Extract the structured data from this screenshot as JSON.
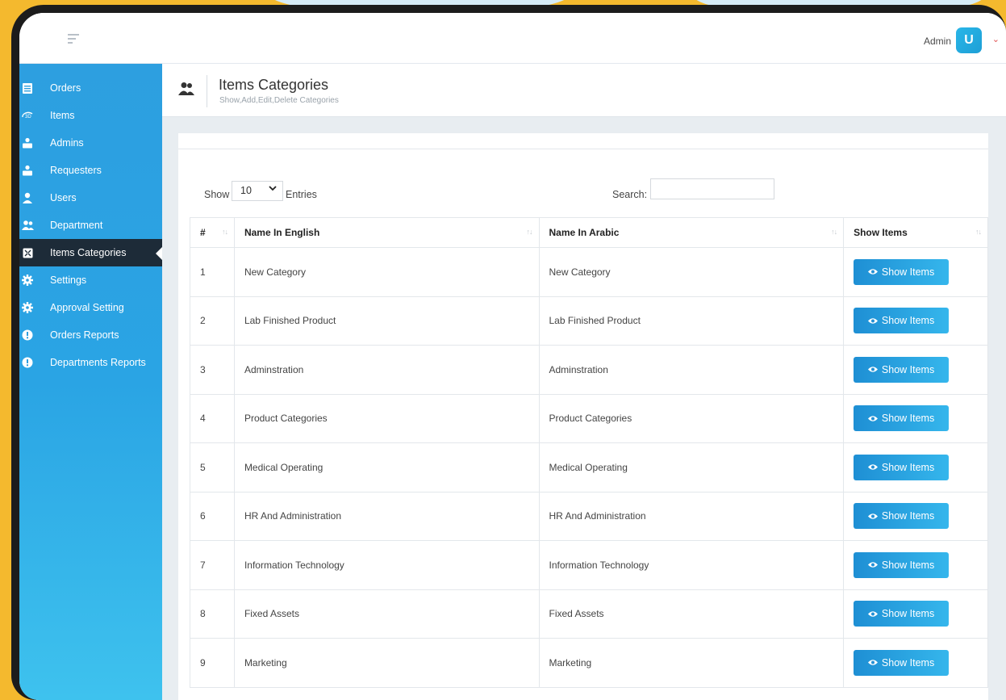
{
  "header": {
    "user_label": "Admin",
    "avatar_letter": "U"
  },
  "sidebar": {
    "items": [
      {
        "label": "Orders",
        "icon": "list-icon",
        "active": false
      },
      {
        "label": "Items",
        "icon": "cube-3d-icon",
        "active": false
      },
      {
        "label": "Admins",
        "icon": "user-group-icon",
        "active": false
      },
      {
        "label": "Requesters",
        "icon": "user-group-icon",
        "active": false
      },
      {
        "label": "Users",
        "icon": "user-icon",
        "active": false
      },
      {
        "label": "Department",
        "icon": "users-icon",
        "active": false
      },
      {
        "label": "Items Categories",
        "icon": "expand-icon",
        "active": true
      },
      {
        "label": "Settings",
        "icon": "gear-icon",
        "active": false
      },
      {
        "label": "Approval Setting",
        "icon": "gear-icon",
        "active": false
      },
      {
        "label": "Orders Reports",
        "icon": "alert-icon",
        "active": false
      },
      {
        "label": "Departments Reports",
        "icon": "alert-icon",
        "active": false
      }
    ]
  },
  "page": {
    "title": "Items Categories",
    "subtitle": "Show,Add,Edit,Delete Categories"
  },
  "controls": {
    "show_label": "Show",
    "entries_value": "10",
    "entries_label": "Entries",
    "search_label": "Search:",
    "search_value": ""
  },
  "table": {
    "columns": [
      "#",
      "Name In English",
      "Name In Arabic",
      "Show Items"
    ],
    "button_label": "Show Items",
    "rows": [
      {
        "num": "1",
        "en": "New Category",
        "ar": "New Category"
      },
      {
        "num": "2",
        "en": "Lab Finished Product",
        "ar": "Lab Finished Product"
      },
      {
        "num": "3",
        "en": "Adminstration",
        "ar": "Adminstration"
      },
      {
        "num": "4",
        "en": "Product Categories",
        "ar": "Product Categories"
      },
      {
        "num": "5",
        "en": "Medical Operating",
        "ar": "Medical Operating"
      },
      {
        "num": "6",
        "en": "HR And Administration",
        "ar": "HR And Administration"
      },
      {
        "num": "7",
        "en": "Information Technology",
        "ar": "Information Technology"
      },
      {
        "num": "8",
        "en": "Fixed Assets",
        "ar": "Fixed Assets"
      },
      {
        "num": "9",
        "en": "Marketing",
        "ar": "Marketing"
      }
    ]
  },
  "colors": {
    "sidebar_top": "#2d9fe0",
    "sidebar_bottom": "#3ec2ee",
    "active_item": "#1d2b38",
    "button": "#2aa4e4",
    "frame_background": "#f4b92e"
  }
}
